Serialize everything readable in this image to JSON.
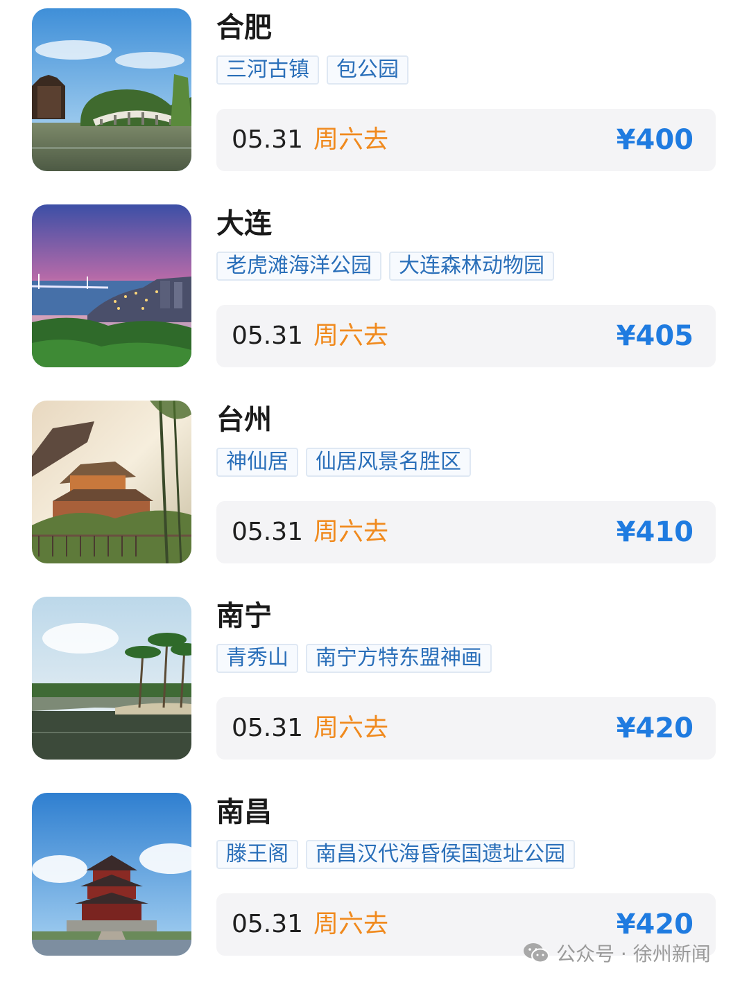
{
  "items": [
    {
      "city": "合肥",
      "tags": [
        "三河古镇",
        "包公园"
      ],
      "date": "05.31",
      "day": "周六去",
      "price": "¥400"
    },
    {
      "city": "大连",
      "tags": [
        "老虎滩海洋公园",
        "大连森林动物园"
      ],
      "date": "05.31",
      "day": "周六去",
      "price": "¥405"
    },
    {
      "city": "台州",
      "tags": [
        "神仙居",
        "仙居风景名胜区"
      ],
      "date": "05.31",
      "day": "周六去",
      "price": "¥410"
    },
    {
      "city": "南宁",
      "tags": [
        "青秀山",
        "南宁方特东盟神画"
      ],
      "date": "05.31",
      "day": "周六去",
      "price": "¥420"
    },
    {
      "city": "南昌",
      "tags": [
        "滕王阁",
        "南昌汉代海昏侯国遗址公园"
      ],
      "date": "05.31",
      "day": "周六去",
      "price": "¥420"
    }
  ],
  "watermark": {
    "text": "公众号 · 徐州新闻",
    "icon": "wechat-icon"
  },
  "colors": {
    "price": "#1f7be0",
    "day": "#f08a1e",
    "tag_text": "#2a6fb9",
    "bar_bg": "#f4f4f6"
  }
}
